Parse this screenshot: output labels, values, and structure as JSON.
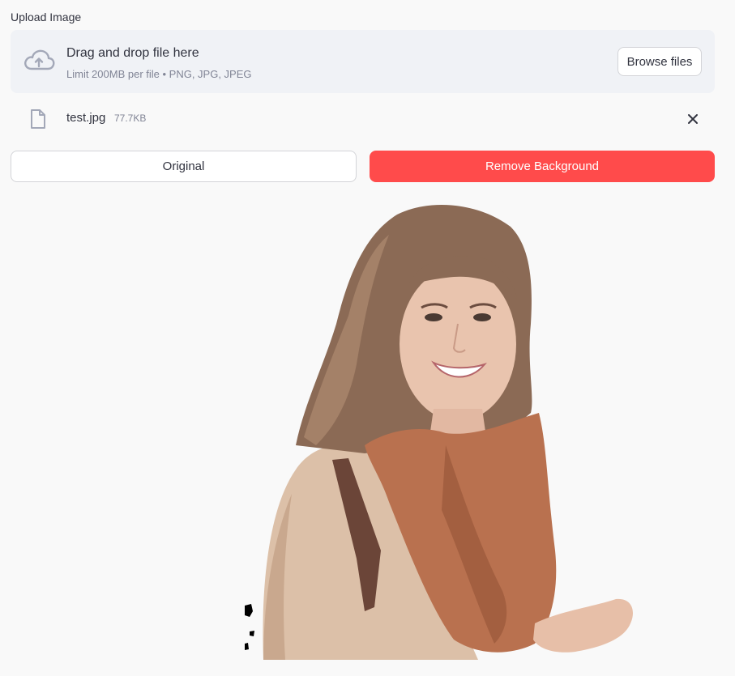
{
  "uploader": {
    "label": "Upload Image",
    "dropzone_title": "Drag and drop file here",
    "dropzone_limit": "Limit 200MB per file • PNG, JPG, JPEG",
    "browse_label": "Browse files"
  },
  "file": {
    "name": "test.jpg",
    "size": "77.7KB"
  },
  "actions": {
    "original_label": "Original",
    "remove_bg_label": "Remove Background"
  },
  "colors": {
    "accent": "#ff4b4b",
    "dropzone_bg": "#f0f2f6",
    "page_bg": "#f9f9f9"
  },
  "icons": {
    "upload": "cloud-upload-icon",
    "file": "file-icon",
    "close": "close-icon"
  }
}
